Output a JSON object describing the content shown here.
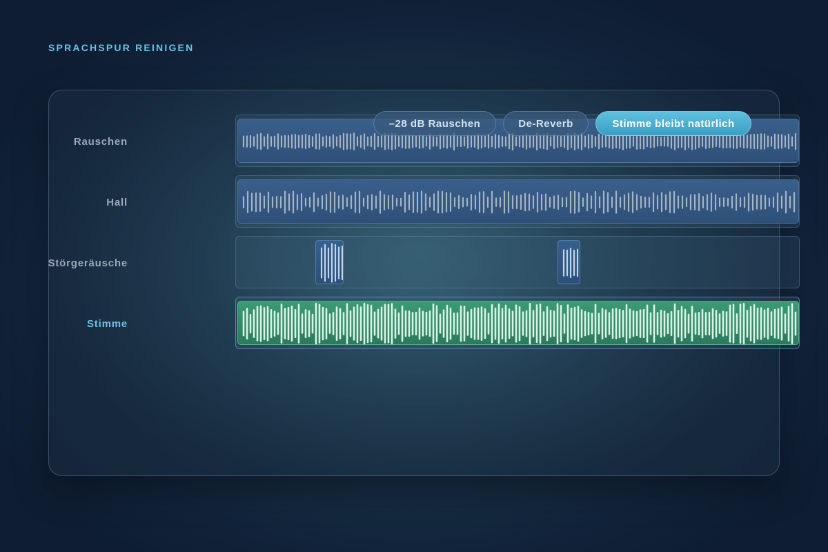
{
  "page": {
    "title": "SPRACHSPUR REINIGEN"
  },
  "tracks": [
    {
      "id": "rauschen",
      "label": "Rauschen",
      "kind": "noise"
    },
    {
      "id": "hall",
      "label": "Hall",
      "kind": "reverb"
    },
    {
      "id": "stoer",
      "label": "Störgeräusche",
      "kind": "transients"
    },
    {
      "id": "stimme",
      "label": "Stimme",
      "kind": "voice",
      "active": true
    }
  ],
  "chips": [
    {
      "label": "–28 dB Rauschen",
      "style": "secondary"
    },
    {
      "label": "De-Reverb",
      "style": "secondary"
    },
    {
      "label": "Stimme bleibt natürlich",
      "style": "primary"
    }
  ],
  "colors": {
    "accent": "#6cc3e6",
    "noise_wave": "#a6b3c3",
    "voice_wave": "#d9f5e6",
    "voice_clip": "#3c9a75",
    "noise_clip": "#3a5f8b"
  }
}
